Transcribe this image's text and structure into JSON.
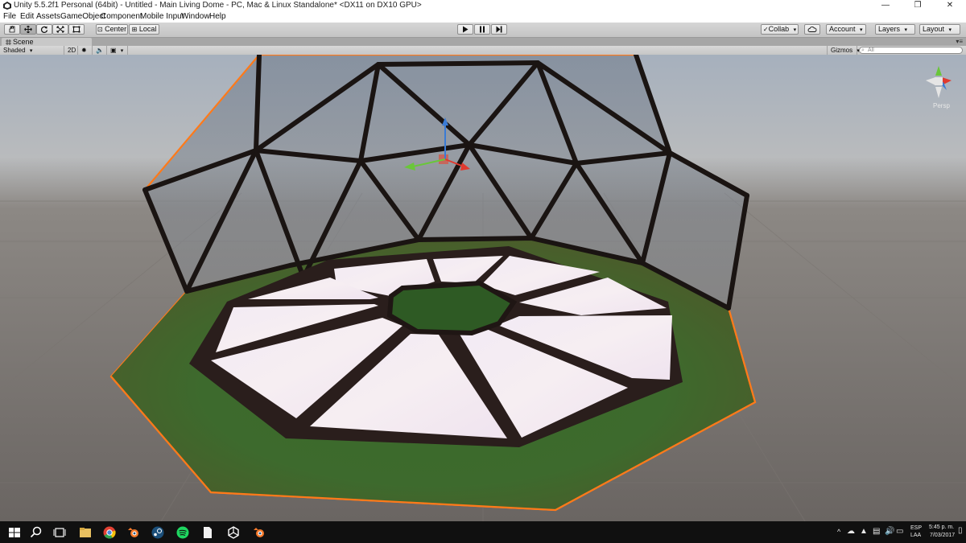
{
  "window": {
    "title": "Unity 5.5.2f1 Personal (64bit) - Untitled - Main Living Dome - PC, Mac & Linux Standalone* <DX11 on DX10 GPU>",
    "minimize": "—",
    "maximize": "❐",
    "close": "✕"
  },
  "menu": [
    "File",
    "Edit",
    "Assets",
    "GameObject",
    "Component",
    "Mobile Input",
    "Window",
    "Help"
  ],
  "toolbar": {
    "tools": [
      "hand-tool",
      "move-tool",
      "rotate-tool",
      "scale-tool",
      "rect-tool"
    ],
    "center_label": "Center",
    "local_label": "Local",
    "collab_label": "Collab",
    "account_label": "Account",
    "layers_label": "Layers",
    "layout_label": "Layout"
  },
  "scene": {
    "tab_label": "Scene",
    "shading_mode": "Shaded",
    "mode_2d": "2D",
    "gizmos_label": "Gizmos",
    "search_placeholder": "All",
    "projection_label": "Persp"
  },
  "taskbar": {
    "language_primary": "ESP",
    "language_secondary": "LAA",
    "time": "5:45 p. m.",
    "date": "7/03/2017"
  },
  "colors": {
    "selection_outline": "#ff7a1a",
    "ground_green": "#3f6b2c",
    "background_grey": "#6f6a66",
    "axis_y": "#3a7bd5",
    "axis_x": "#e03a2f",
    "axis_z": "#6ac63a"
  }
}
